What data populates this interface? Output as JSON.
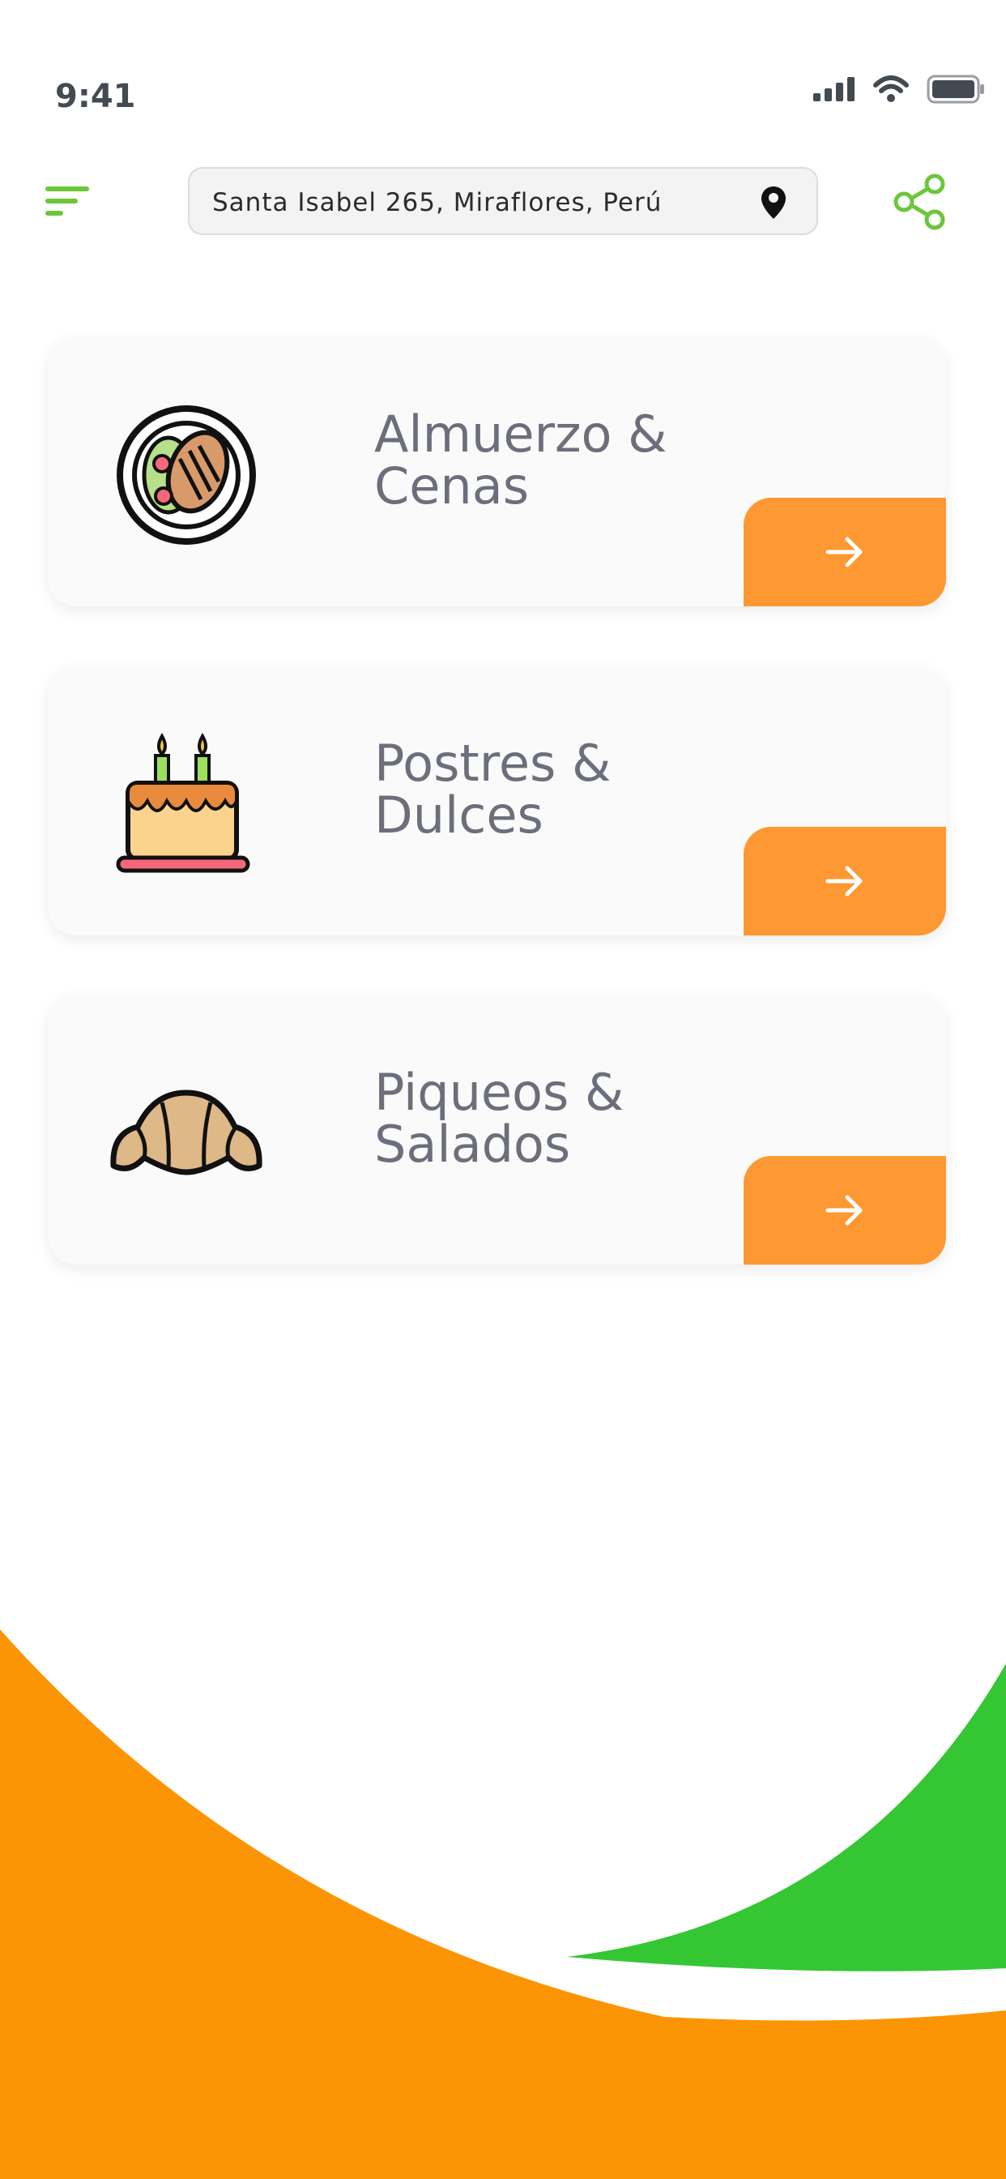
{
  "status": {
    "time": "9:41"
  },
  "header": {
    "address": "Santa Isabel 265, Miraflores, Perú"
  },
  "categories": [
    {
      "title": "Almuerzo & Cenas",
      "line1": "Almuerzo &",
      "line2": "Cenas",
      "icon": "meal-plate-icon"
    },
    {
      "title": "Postres & Dulces",
      "line1": "Postres &",
      "line2": "Dulces",
      "icon": "birthday-cake-icon"
    },
    {
      "title": "Piqueos & Salados",
      "line1": "Piqueos &",
      "line2": "Salados",
      "icon": "croissant-icon"
    }
  ],
  "colors": {
    "accent_orange": "#fd9833",
    "wave_orange": "#fc9505",
    "wave_green": "#35c634",
    "menu_green": "#6cc63a",
    "title_gray": "#6c6f7b"
  }
}
